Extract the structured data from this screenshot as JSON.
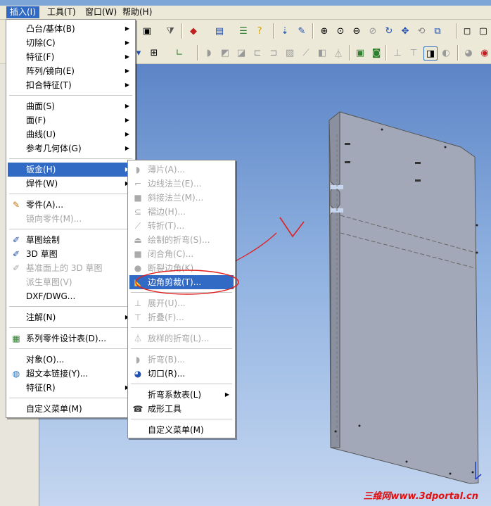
{
  "menubar": {
    "items": [
      "插入(I)",
      "工具(T)",
      "窗口(W)",
      "帮助(H)"
    ]
  },
  "insert_menu": {
    "items": [
      {
        "label": "凸台/基体(B)"
      },
      {
        "label": "切除(C)"
      },
      {
        "label": "特征(F)"
      },
      {
        "label": "阵列/镜向(E)"
      },
      {
        "label": "扣合特征(T)"
      },
      {
        "label": "曲面(S)"
      },
      {
        "label": "面(F)"
      },
      {
        "label": "曲线(U)"
      },
      {
        "label": "参考几何体(G)"
      },
      {
        "label": "钣金(H)"
      },
      {
        "label": "焊件(W)"
      },
      {
        "label": "零件(A)..."
      },
      {
        "label": "镜向零件(M)..."
      },
      {
        "label": "草图绘制"
      },
      {
        "label": "3D 草图"
      },
      {
        "label": "基准面上的 3D 草图"
      },
      {
        "label": "派生草图(V)"
      },
      {
        "label": "DXF/DWG..."
      },
      {
        "label": "注解(N)"
      },
      {
        "label": "系列零件设计表(D)..."
      },
      {
        "label": "对象(O)..."
      },
      {
        "label": "超文本链接(Y)..."
      },
      {
        "label": "特征(R)"
      },
      {
        "label": "自定义菜单(M)"
      }
    ]
  },
  "sheetmetal_menu": {
    "items": [
      {
        "label": "薄片(A)..."
      },
      {
        "label": "边线法兰(E)..."
      },
      {
        "label": "斜接法兰(M)..."
      },
      {
        "label": "褶边(H)..."
      },
      {
        "label": "转折(T)..."
      },
      {
        "label": "绘制的折弯(S)..."
      },
      {
        "label": "闭合角(C)..."
      },
      {
        "label": "断裂边角(K)..."
      },
      {
        "label": "边角剪裁(T)..."
      },
      {
        "label": "展开(U)..."
      },
      {
        "label": "折叠(F)..."
      },
      {
        "label": "放样的折弯(L)..."
      },
      {
        "label": "折弯(B)..."
      },
      {
        "label": "切口(R)..."
      },
      {
        "label": "折弯系数表(L)"
      },
      {
        "label": "成形工具"
      },
      {
        "label": "自定义菜单(M)"
      }
    ]
  },
  "watermark": "三维网www.3dportal.cn",
  "colors": {
    "highlight": "#316ac5",
    "annotation": "#e02020",
    "menubar": "#ece9d8"
  }
}
